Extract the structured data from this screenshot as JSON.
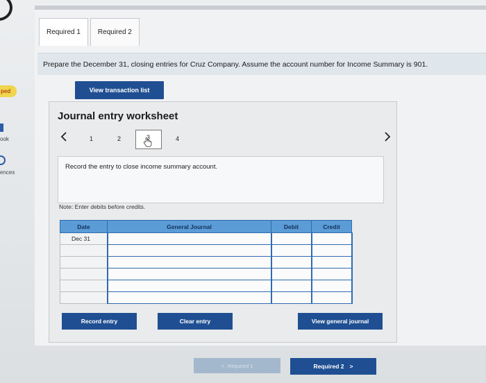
{
  "sidebar": {
    "badge_text": "ped",
    "fragment_book": "ook",
    "fragment_references": "ences"
  },
  "tabs": [
    {
      "label": "Required 1",
      "active": true
    },
    {
      "label": "Required 2",
      "active": false
    }
  ],
  "instruction": "Prepare the December 31, closing entries for Cruz Company. Assume the account number for Income Summary is 901.",
  "view_transaction_label": "View transaction list",
  "worksheet": {
    "title": "Journal entry worksheet",
    "prev_icon": "chevron-left-icon",
    "next_icon": "chevron-right-icon",
    "steps": [
      "1",
      "2",
      "3",
      "4"
    ],
    "current_step": "3",
    "prompt": "Record the entry to close income summary account.",
    "note": "Note: Enter debits before credits.",
    "columns": {
      "date": "Date",
      "general_journal": "General Journal",
      "debit": "Debit",
      "credit": "Credit"
    },
    "rows": [
      {
        "date": "Dec 31",
        "account": "",
        "debit": "",
        "credit": ""
      },
      {
        "date": "",
        "account": "",
        "debit": "",
        "credit": ""
      },
      {
        "date": "",
        "account": "",
        "debit": "",
        "credit": ""
      },
      {
        "date": "",
        "account": "",
        "debit": "",
        "credit": ""
      },
      {
        "date": "",
        "account": "",
        "debit": "",
        "credit": ""
      },
      {
        "date": "",
        "account": "",
        "debit": "",
        "credit": ""
      }
    ],
    "record_label": "Record entry",
    "clear_label": "Clear entry",
    "view_journal_label": "View general journal"
  },
  "navigation": {
    "prev_label": "Required 1",
    "prev_icon": "chevron-left-icon",
    "next_label": "Required 2",
    "next_icon": "chevron-right-icon"
  },
  "colors": {
    "primary_button": "#1f4f92",
    "table_header": "#5b9bd6",
    "table_border": "#2f6bb0",
    "badge": "#f0d54e"
  }
}
